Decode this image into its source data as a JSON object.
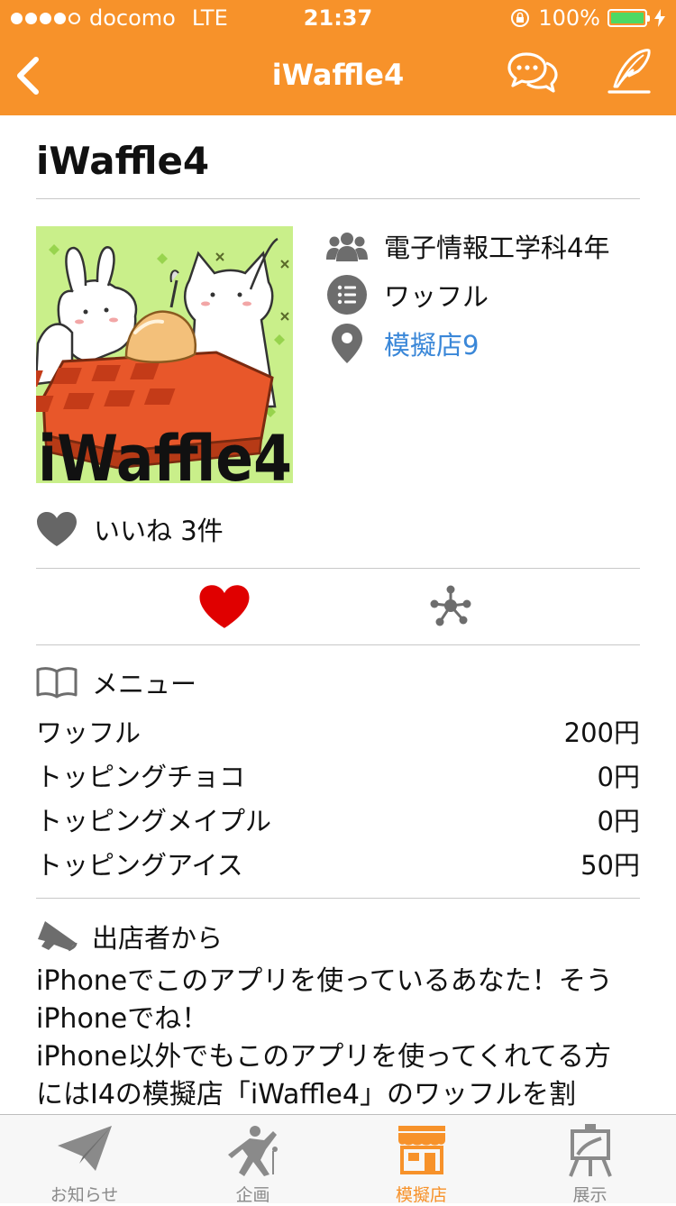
{
  "status_bar": {
    "carrier": "docomo",
    "network": "LTE",
    "time": "21:37",
    "battery": "100%"
  },
  "nav": {
    "title": "iWaffle4"
  },
  "shop": {
    "name": "iWaffle4",
    "department": "電子情報工学科4年",
    "category": "ワッフル",
    "location": "模擬店9",
    "thumbnail_text": "iWaffle4"
  },
  "likes": {
    "label": "いいね 3件"
  },
  "menu": {
    "heading": "メニュー",
    "items": [
      {
        "name": "ワッフル",
        "price": "200円"
      },
      {
        "name": "トッピングチョコ",
        "price": "0円"
      },
      {
        "name": "トッピングメイプル",
        "price": "0円"
      },
      {
        "name": "トッピングアイス",
        "price": "50円"
      }
    ]
  },
  "message": {
    "heading": "出店者から",
    "body": "iPhoneでこのアプリを使っているあなた！そう\niPhoneでね！\niPhone以外でもこのアプリを使ってくれてる方\nにはI4の模擬店「iWaffle4」のワッフルを割"
  },
  "tabs": [
    {
      "label": "お知らせ",
      "active": false
    },
    {
      "label": "企画",
      "active": false
    },
    {
      "label": "模擬店",
      "active": true
    },
    {
      "label": "展示",
      "active": false
    }
  ],
  "colors": {
    "accent": "#f7922a",
    "link": "#3a87d8",
    "like_heart": "#e00000",
    "icon_gray": "#6d6d6d"
  }
}
